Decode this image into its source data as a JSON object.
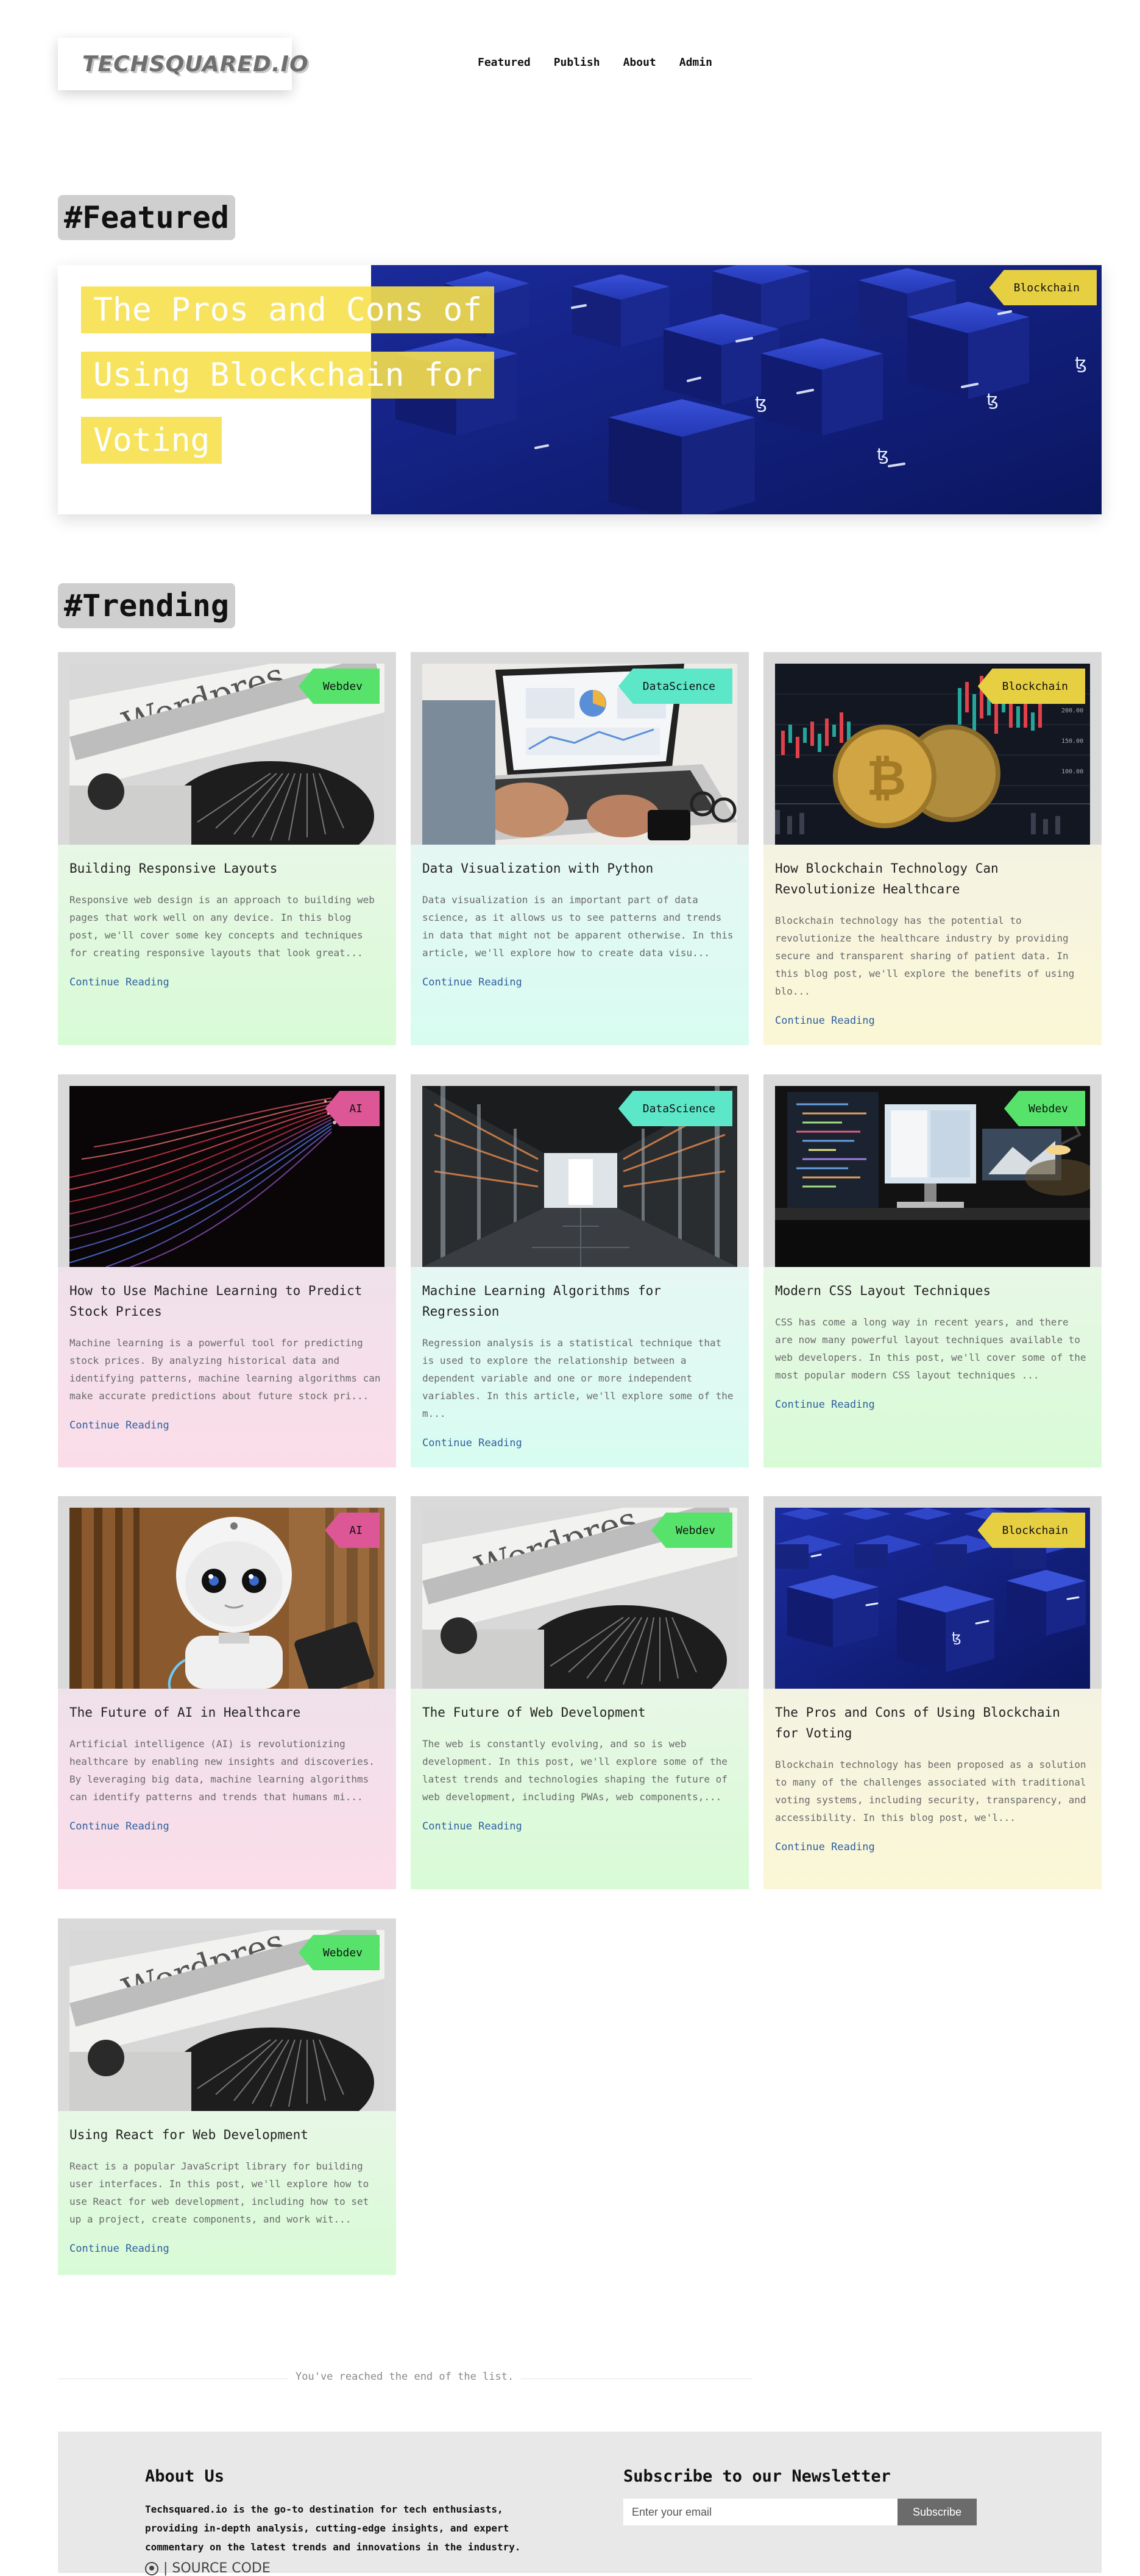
{
  "header": {
    "logo": "TECHSQUARED.IO",
    "nav": [
      "Featured",
      "Publish",
      "About",
      "Admin"
    ]
  },
  "featured": {
    "heading": "#Featured",
    "title": "The Pros and Cons of Using Blockchain for Voting",
    "tag": "Blockchain"
  },
  "trending": {
    "heading": "#Trending",
    "cards": [
      {
        "tag": "Webdev",
        "image": "typewriter",
        "title": "Building Responsive Layouts",
        "excerpt": "Responsive web design is an approach to building web pages that work well on any device. In this blog post, we'll cover some key concepts and techniques for creating responsive layouts that look great...",
        "link": "Continue Reading"
      },
      {
        "tag": "DataScience",
        "image": "laptop",
        "title": "Data Visualization with Python",
        "excerpt": "Data visualization is an important part of data science, as it allows us to see patterns and trends in data that might not be apparent otherwise. In this article, we'll explore how to create data visu...",
        "link": "Continue Reading"
      },
      {
        "tag": "Blockchain",
        "image": "coins",
        "title": "How Blockchain Technology Can Revolutionize Healthcare",
        "excerpt": "Blockchain technology has the potential to revolutionize the healthcare industry by providing secure and transparent sharing of patient data. In this blog post, we'll explore the benefits of using blo...",
        "link": "Continue Reading"
      },
      {
        "tag": "AI",
        "image": "fiber",
        "title": "How to Use Machine Learning to Predict Stock Prices",
        "excerpt": "Machine learning is a powerful tool for predicting stock prices. By analyzing historical data and identifying patterns, machine learning algorithms can make accurate predictions about future stock pri...",
        "link": "Continue Reading"
      },
      {
        "tag": "DataScience",
        "image": "servers",
        "title": "Machine Learning Algorithms for Regression",
        "excerpt": "Regression analysis is a statistical technique that is used to explore the relationship between a dependent variable and one or more independent variables. In this article, we'll explore some of the m...",
        "link": "Continue Reading"
      },
      {
        "tag": "Webdev",
        "image": "desk",
        "title": "Modern CSS Layout Techniques",
        "excerpt": "CSS has come a long way in recent years, and there are now many powerful layout techniques available to web developers. In this post, we'll cover some of the most popular modern CSS layout techniques ...",
        "link": "Continue Reading"
      },
      {
        "tag": "AI",
        "image": "robot",
        "title": "The Future of AI in Healthcare",
        "excerpt": "Artificial intelligence (AI) is revolutionizing healthcare by enabling new insights and discoveries. By leveraging big data, machine learning algorithms can identify patterns and trends that humans mi...",
        "link": "Continue Reading"
      },
      {
        "tag": "Webdev",
        "image": "typewriter",
        "title": "The Future of Web Development",
        "excerpt": "The web is constantly evolving, and so is web development. In this post, we'll explore some of the latest trends and technologies shaping the future of web development, including PWAs, web components,...",
        "link": "Continue Reading"
      },
      {
        "tag": "Blockchain",
        "image": "cubes",
        "title": "The Pros and Cons of Using Blockchain for Voting",
        "excerpt": "Blockchain technology has been proposed as a solution to many of the challenges associated with traditional voting systems, including security, transparency, and accessibility. In this blog post, we'l...",
        "link": "Continue Reading"
      },
      {
        "tag": "Webdev",
        "image": "typewriter",
        "title": "Using React for Web Development",
        "excerpt": "React is a popular JavaScript library for building user interfaces. In this post, we'll explore how to use React for web development, including how to set up a project, create components, and work wit...",
        "link": "Continue Reading"
      }
    ]
  },
  "end_of_list": "You've reached the end of the list.",
  "footer": {
    "about_heading": "About Us",
    "about_text": "Techsquared.io is the go-to destination for tech enthusiasts, providing in-depth analysis, cutting-edge insights, and expert commentary on the latest trends and innovations in the industry.",
    "source_label": "| SOURCE CODE",
    "newsletter_heading": "Subscribe to our Newsletter",
    "email_placeholder": "Enter your email",
    "subscribe_label": "Subscribe"
  },
  "colors": {
    "featured_highlight": "#f6e04c",
    "webdev": "#57e36b",
    "datascience": "#5ce8c8",
    "blockchain": "#e7cf42",
    "ai": "#dd5796",
    "link": "#2f5f9e"
  }
}
